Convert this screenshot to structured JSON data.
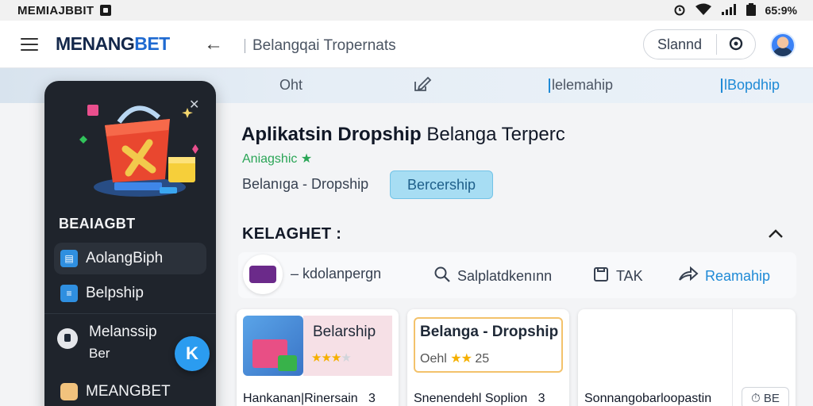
{
  "status_bar": {
    "carrier": "MEMIAJBBIT",
    "battery": "65:9%",
    "icons": [
      "alarm-icon",
      "wifi-icon",
      "signal-icon",
      "battery-icon"
    ]
  },
  "app_bar": {
    "brand_main": "MENANG",
    "brand_accent": "BET",
    "page_title": "Belangqai Tropernats",
    "search_pill": "Slannd",
    "icons": [
      "menu-icon",
      "back-arrow-icon",
      "pill-action-icon",
      "avatar"
    ]
  },
  "tabs": [
    {
      "label": "Oht"
    },
    {
      "label": "✎"
    },
    {
      "label": "lelemahip"
    },
    {
      "label": "lBopdhip"
    }
  ],
  "drawer": {
    "title": "BEAIAGBT",
    "items": [
      {
        "label": "AolangBiph",
        "icon": "store-icon"
      },
      {
        "label": "Belpship",
        "icon": "list-icon"
      },
      {
        "label": "Melanssip",
        "sub": "Ber",
        "icon": "chat-icon"
      },
      {
        "label": "MEANGBET",
        "icon": "bag-icon"
      }
    ],
    "fab_label": "K"
  },
  "main": {
    "title_bold": "Aplikatsin Dropship",
    "title_rest": " Belanga Terperc",
    "subtitle": "Aniagshic ★",
    "breadcrumb": "Belanıga - Dropship",
    "cta_label": "Bercership",
    "section_head": "KELAGHET :",
    "actions": [
      {
        "label": "– kdolanpergn",
        "icon": "logo-badge"
      },
      {
        "label": "Salplatdkenınn",
        "icon": "search-icon"
      },
      {
        "label": "TAK",
        "icon": "tag-icon"
      },
      {
        "label": "Reamahip",
        "icon": "share-icon"
      }
    ]
  },
  "cards": [
    {
      "title": "Belarship",
      "rating_label": "",
      "stars": 3,
      "foot": "Hankanan|Rinersain",
      "foot_icon": "3"
    },
    {
      "title": "Belanga - Dropship",
      "rating_label": "Oehl",
      "stars": 2,
      "rating_value": "25",
      "foot": "Snenendehl Soplion",
      "foot_icon": "3"
    },
    {
      "title": "",
      "foot": "Sonnangobarloopastin",
      "chip": "⏱ BE"
    }
  ],
  "colors": {
    "brand_dark": "#14284b",
    "brand_blue": "#1f6ad1",
    "drawer_bg": "#1f242c",
    "accent": "#1f8ad6",
    "cta_bg": "#a7ddf3",
    "green": "#2aa556"
  }
}
